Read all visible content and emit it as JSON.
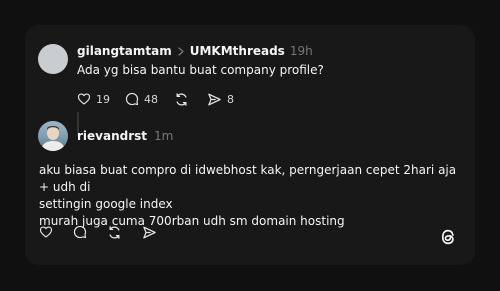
{
  "post": {
    "username": "gilangtamtam",
    "community": "UMKMthreads",
    "time": "19h",
    "text": "Ada yg bisa bantu buat company profile?",
    "likes": "19",
    "comments": "48",
    "shares": "8"
  },
  "reply": {
    "username": "rievandrst",
    "time": "1m",
    "lines": [
      "aku biasa buat compro di idwebhost kak, perngerjaan cepet 2hari aja + udh di",
      "settingin google index",
      "murah juga cuma 700rban udh sm domain hosting"
    ]
  },
  "icons": {
    "like": "heart-icon",
    "comment": "comment-icon",
    "repost": "repost-icon",
    "share": "send-icon",
    "logo": "threads-logo-icon"
  }
}
